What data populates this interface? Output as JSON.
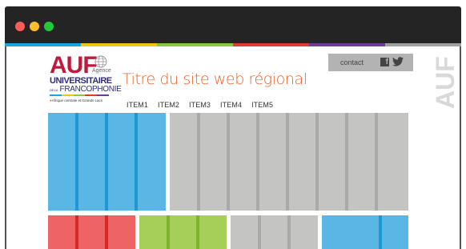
{
  "window": {
    "controls": [
      "close",
      "minimize",
      "maximize"
    ]
  },
  "colors": {
    "band": [
      "#19a5e2",
      "#f1c40f",
      "#8cc63f",
      "#e53935",
      "#6a3e98",
      "#a0a0a0"
    ]
  },
  "logo": {
    "acronym": "AUF",
    "agence": "Agence",
    "line1": "UNIVERSITAIRE",
    "line2": "FRANCOPHONIE",
    "line2_prefix": "DE LA",
    "region": "Afrique centrale et Grands Lacs"
  },
  "header": {
    "site_title": "Titre du site web régional",
    "contact": "contact",
    "side_logo": "AUF"
  },
  "menu": {
    "items": [
      "ITEM1",
      "ITEM2",
      "ITEM3",
      "ITEM4",
      "ITEM5"
    ]
  },
  "icons": [
    "facebook-icon",
    "twitter-icon",
    "globe-icon"
  ]
}
